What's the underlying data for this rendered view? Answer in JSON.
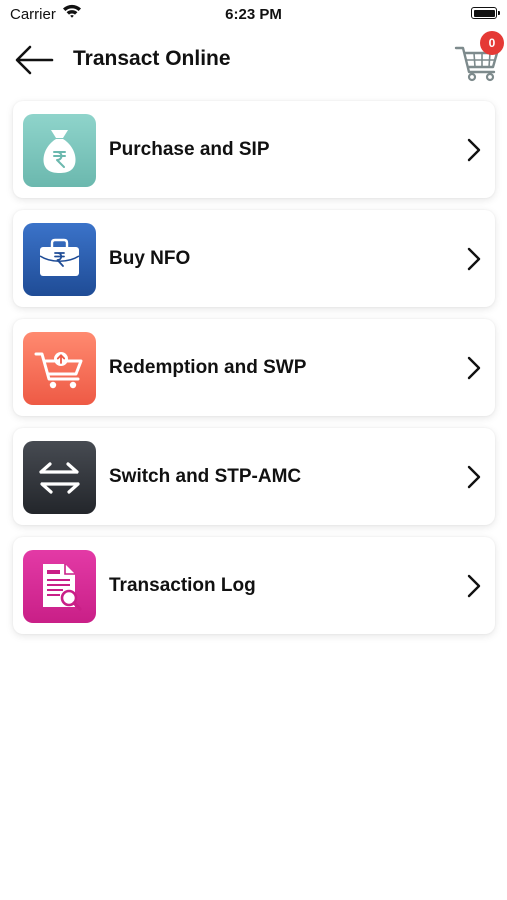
{
  "status_bar": {
    "carrier": "Carrier",
    "time": "6:23 PM"
  },
  "header": {
    "title": "Transact Online",
    "cart_count": "0",
    "back_icon": "arrow-left-icon",
    "cart_icon": "shopping-cart-icon"
  },
  "menu": {
    "items": [
      {
        "label": "Purchase and SIP",
        "icon": "money-bag-icon",
        "color": "#7fc8c0"
      },
      {
        "label": "Buy NFO",
        "icon": "briefcase-rupee-icon",
        "color": "#2d5fb0"
      },
      {
        "label": "Redemption and SWP",
        "icon": "cart-upload-icon",
        "color": "#f47560"
      },
      {
        "label": "Switch and STP-AMC",
        "icon": "switch-arrows-icon",
        "color": "#33363b"
      },
      {
        "label": "Transaction Log",
        "icon": "document-search-icon",
        "color": "#d42c96"
      }
    ]
  }
}
